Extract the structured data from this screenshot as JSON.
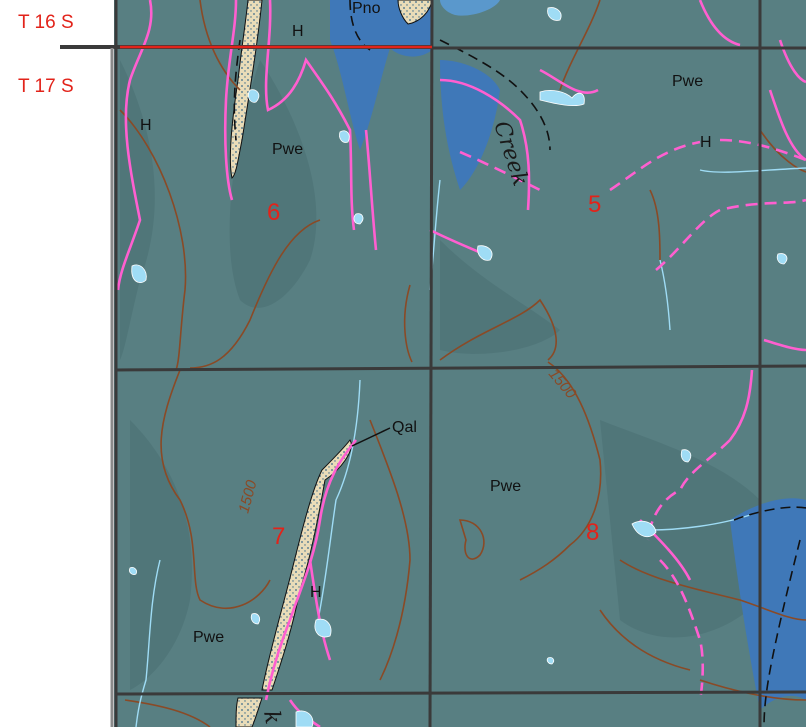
{
  "township_labels": {
    "north": "T 16 S",
    "south": "T 17 S"
  },
  "section_numbers": [
    "5",
    "6",
    "7",
    "8"
  ],
  "geologic_units": {
    "pwe": "Pwe",
    "pno": "Pno",
    "qal": "Qal",
    "h": "H"
  },
  "contour_label": "1500",
  "stream_name_fragments": {
    "creek": "Creek",
    "k": "k"
  },
  "colors": {
    "background": "#587f82",
    "shadow": "#4b6f73",
    "creek_blue": "#3f78b8",
    "creek_blue_light": "#5b9bd4",
    "contact_pink": "#ff5fd0",
    "contour_brown": "#8a4a26",
    "section_line": "#3a3a3a",
    "township_line": "#e2231a",
    "water": "#9fdcf5",
    "alluvium": "#e9dcb8",
    "section_number": "#e2231a"
  }
}
